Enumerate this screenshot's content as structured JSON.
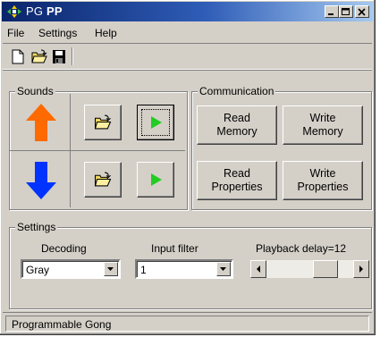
{
  "window": {
    "title_prefix": "PG ",
    "title_bold": "PP",
    "controls": [
      "minimize-icon",
      "maximize-icon",
      "close-icon"
    ]
  },
  "menu": {
    "items": [
      "File",
      "Settings",
      "Help"
    ]
  },
  "toolbar": {
    "icons": [
      "new-file-icon",
      "open-folder-icon",
      "save-disk-icon"
    ]
  },
  "sounds": {
    "label": "Sounds",
    "up_arrow_color": "#ff6a00",
    "down_arrow_color": "#0033ff",
    "play_color": "#22cc22"
  },
  "communication": {
    "label": "Communication",
    "read_memory": [
      "Read",
      "Memory"
    ],
    "write_memory": [
      "Write",
      "Memory"
    ],
    "read_properties": [
      "Read",
      "Properties"
    ],
    "write_properties": [
      "Write",
      "Properties"
    ]
  },
  "settings": {
    "label": "Settings",
    "decoding_label": "Decoding",
    "decoding_value": "Gray",
    "input_filter_label": "Input filter",
    "input_filter_value": "1",
    "playback_delay_label": "Playback delay=12",
    "playback_delay_value": 12
  },
  "status": {
    "text": "Programmable Gong"
  }
}
